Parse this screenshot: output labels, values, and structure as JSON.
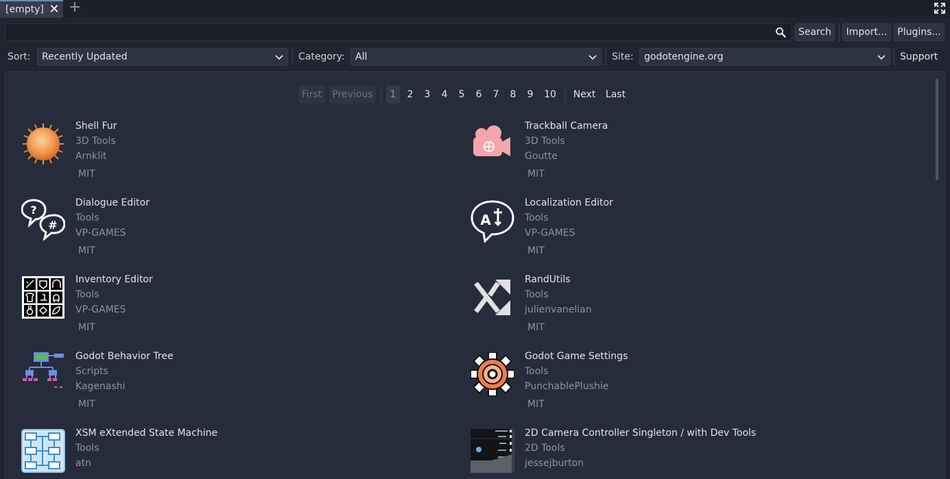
{
  "tab": {
    "label": "[empty]"
  },
  "search": {
    "placeholder": "",
    "button": "Search"
  },
  "toolbar": {
    "import": "Import...",
    "plugins": "Plugins..."
  },
  "filters": {
    "sort_label": "Sort:",
    "sort_value": "Recently Updated",
    "category_label": "Category:",
    "category_value": "All",
    "site_label": "Site:",
    "site_value": "godotengine.org",
    "support": "Support"
  },
  "pager": {
    "first": "First",
    "previous": "Previous",
    "pages": [
      "1",
      "2",
      "3",
      "4",
      "5",
      "6",
      "7",
      "8",
      "9",
      "10"
    ],
    "current": "1",
    "next": "Next",
    "last": "Last"
  },
  "assets": [
    {
      "title": "Shell Fur",
      "category": "3D Tools",
      "author": "Arnklit",
      "license": "MIT",
      "icon": "fur-ball-icon"
    },
    {
      "title": "Trackball Camera",
      "category": "3D Tools",
      "author": "Goutte",
      "license": "MIT",
      "icon": "camera-icon"
    },
    {
      "title": "Dialogue Editor",
      "category": "Tools",
      "author": "VP-GAMES",
      "license": "MIT",
      "icon": "dialogue-bubbles-icon"
    },
    {
      "title": "Localization Editor",
      "category": "Tools",
      "author": "VP-GAMES",
      "license": "MIT",
      "icon": "translate-bubble-icon"
    },
    {
      "title": "Inventory Editor",
      "category": "Tools",
      "author": "VP-GAMES",
      "license": "MIT",
      "icon": "inventory-grid-icon"
    },
    {
      "title": "RandUtils",
      "category": "Tools",
      "author": "julienvanelian",
      "license": "MIT",
      "icon": "shuffle-icon"
    },
    {
      "title": "Godot Behavior Tree",
      "category": "Scripts",
      "author": "Kagenashi",
      "license": "MIT",
      "icon": "behavior-tree-icon"
    },
    {
      "title": "Godot Game Settings",
      "category": "Tools",
      "author": "PunchablePlushie",
      "license": "MIT",
      "icon": "gear-icon"
    },
    {
      "title": "XSM eXtended State Machine",
      "category": "Tools",
      "author": "atn",
      "license": "",
      "icon": "state-machine-icon"
    },
    {
      "title": "2D Camera Controller Singleton / with Dev Tools",
      "category": "2D Tools",
      "author": "jessejburton",
      "license": "",
      "icon": "camera-preview-icon"
    }
  ],
  "colors": {
    "background": "#202531",
    "panel": "#262c3b",
    "accent": "#6f8ab3"
  }
}
